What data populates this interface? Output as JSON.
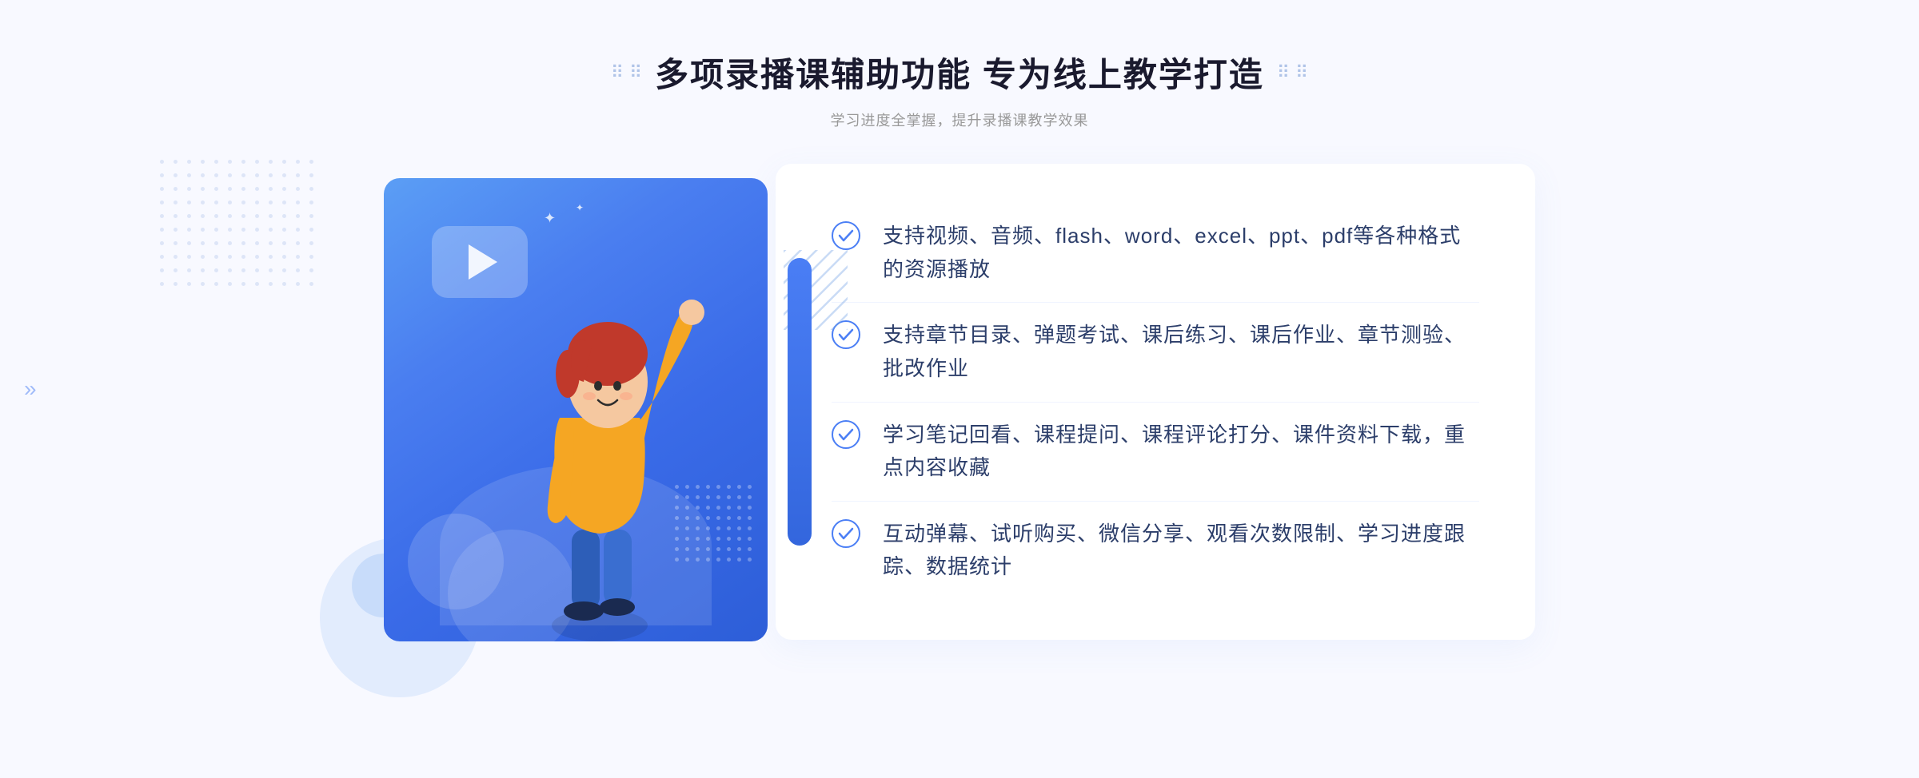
{
  "header": {
    "title": "多项录播课辅助功能 专为线上教学打造",
    "subtitle": "学习进度全掌握，提升录播课教学效果",
    "title_dots_count": 4
  },
  "features": [
    {
      "id": 1,
      "text": "支持视频、音频、flash、word、excel、ppt、pdf等各种格式的资源播放"
    },
    {
      "id": 2,
      "text": "支持章节目录、弹题考试、课后练习、课后作业、章节测验、批改作业"
    },
    {
      "id": 3,
      "text": "学习笔记回看、课程提问、课程评论打分、课件资料下载，重点内容收藏"
    },
    {
      "id": 4,
      "text": "互动弹幕、试听购买、微信分享、观看次数限制、学习进度跟踪、数据统计"
    }
  ],
  "colors": {
    "primary_blue": "#4a7ef5",
    "dark_blue": "#2d5ed8",
    "light_blue": "#e8f0fe",
    "text_dark": "#2c3e6a",
    "text_gray": "#999999",
    "check_color": "#4a7ef5"
  },
  "decorations": {
    "left_arrow": "»",
    "dots_symbol": "⋮⋮"
  }
}
